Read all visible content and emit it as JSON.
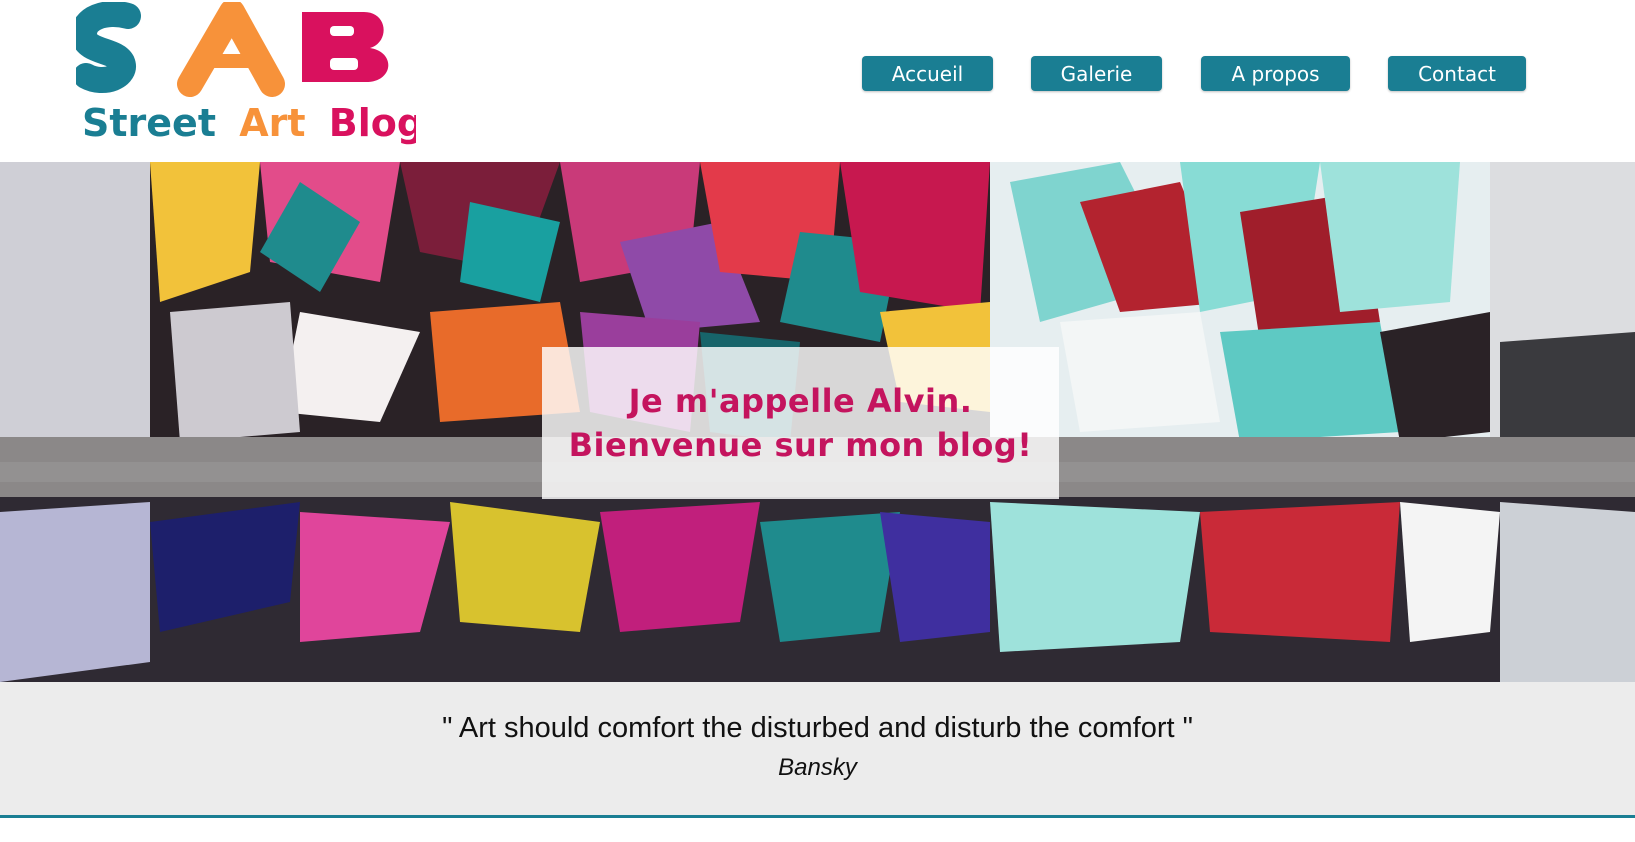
{
  "brand": {
    "logo_letters": [
      "S",
      "A",
      "B"
    ],
    "logo_tagline": [
      "Street",
      "Art",
      "Blog"
    ],
    "colors": {
      "teal": "#1a7e93",
      "orange": "#f7923a",
      "magenta": "#d9115e",
      "navy": "#2b2d4a"
    }
  },
  "nav": {
    "items": [
      {
        "label": "Accueil"
      },
      {
        "label": "Galerie"
      },
      {
        "label": "A propos"
      },
      {
        "label": "Contact"
      }
    ],
    "button_color": "#1a7e93"
  },
  "hero": {
    "line1": "Je m'appelle Alvin.",
    "line2": "Bienvenue sur mon blog!",
    "text_color": "#c4145e",
    "image": "graffiti-wall-photo"
  },
  "quote": {
    "text": "\" Art should comfort the disturbed and disturb the comfort \"",
    "author": "Bansky"
  }
}
